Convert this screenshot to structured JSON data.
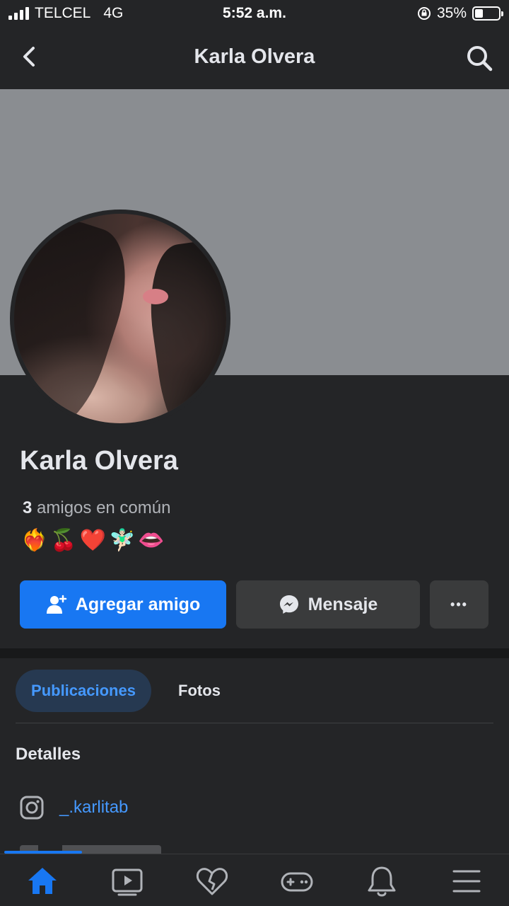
{
  "status_bar": {
    "carrier": "TELCEL",
    "network": "4G",
    "time": "5:52 a.m.",
    "battery": "35%",
    "battery_level": 0.35
  },
  "header": {
    "title": "Karla Olvera",
    "back_icon": "chevron-left-icon",
    "search_icon": "search-icon"
  },
  "profile": {
    "name": "Karla Olvera",
    "mutual_count": "3",
    "mutual_label": "amigos en común",
    "emojis": "❤️‍🔥🍒❤️🧚🏻‍♂️👄"
  },
  "actions": {
    "add_friend": "Agregar amigo",
    "message": "Mensaje",
    "more": "•••"
  },
  "tabs": [
    {
      "label": "Publicaciones",
      "active": true
    },
    {
      "label": "Fotos",
      "active": false
    }
  ],
  "details": {
    "title": "Detalles",
    "instagram": "_.karlitab"
  },
  "bottom_nav": [
    {
      "icon": "home-icon",
      "active": true
    },
    {
      "icon": "video-icon",
      "active": false
    },
    {
      "icon": "dating-heart-icon",
      "active": false
    },
    {
      "icon": "gaming-icon",
      "active": false
    },
    {
      "icon": "bell-icon",
      "active": false
    },
    {
      "icon": "menu-icon",
      "active": false
    }
  ],
  "colors": {
    "accent": "#1877f2",
    "background": "#242527",
    "cover": "#8a8d91",
    "link": "#4599ff"
  }
}
